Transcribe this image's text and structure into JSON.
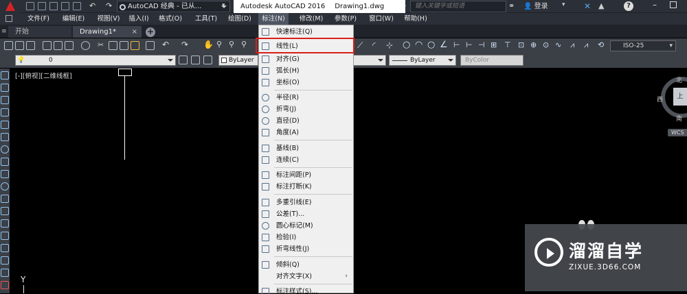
{
  "titlebar": {
    "workspace": "AutoCAD 经典 - 已从...",
    "app_name": "Autodesk AutoCAD 2016",
    "file_name": "Drawing1.dwg",
    "search_placeholder": "键入关键字或短语",
    "login": "登录"
  },
  "menubar": [
    {
      "label": "文件(F)"
    },
    {
      "label": "编辑(E)"
    },
    {
      "label": "视图(V)"
    },
    {
      "label": "插入(I)"
    },
    {
      "label": "格式(O)"
    },
    {
      "label": "工具(T)"
    },
    {
      "label": "绘图(D)"
    },
    {
      "label": "标注(N)"
    },
    {
      "label": "修改(M)"
    },
    {
      "label": "参数(P)"
    },
    {
      "label": "窗口(W)"
    },
    {
      "label": "帮助(H)"
    }
  ],
  "tabs": [
    {
      "label": "开始"
    },
    {
      "label": "Drawing1*"
    }
  ],
  "tab_add": "+",
  "toolbar": {
    "dimstyle": "ISO-25",
    "layer": "0",
    "color": "ByLayer",
    "linetype": "ByLayer",
    "plotstyle": "ByColor"
  },
  "canvas": {
    "view_label": "[-][俯视][二维线框]",
    "ucs_y": "Y"
  },
  "viewcube": {
    "north": "北",
    "west": "西",
    "south": "南",
    "top": "上",
    "wcs": "WCS"
  },
  "dropdown": {
    "items": [
      {
        "label": "快速标注(Q)"
      },
      {
        "label": "线性(L)"
      },
      {
        "label": "对齐(G)"
      },
      {
        "label": "弧长(H)"
      },
      {
        "label": "坐标(O)"
      },
      {
        "label": "半径(R)"
      },
      {
        "label": "折弯(J)"
      },
      {
        "label": "直径(D)"
      },
      {
        "label": "角度(A)"
      },
      {
        "label": "基线(B)"
      },
      {
        "label": "连续(C)"
      },
      {
        "label": "标注间距(P)"
      },
      {
        "label": "标注打断(K)"
      },
      {
        "label": "多重引线(E)"
      },
      {
        "label": "公差(T)..."
      },
      {
        "label": "圆心标记(M)"
      },
      {
        "label": "检验(I)"
      },
      {
        "label": "折弯线性(J)"
      },
      {
        "label": "倾斜(Q)"
      },
      {
        "label": "对齐文字(X)"
      },
      {
        "label": "标注样式(S)..."
      }
    ],
    "submenu_arrow": "›"
  },
  "watermark": {
    "title": "溜溜自学",
    "url": "ZIXUE.3D66.COM"
  },
  "colors": {
    "highlight": "#d91e18",
    "background": "#000000",
    "chrome": "#3b3f46"
  }
}
